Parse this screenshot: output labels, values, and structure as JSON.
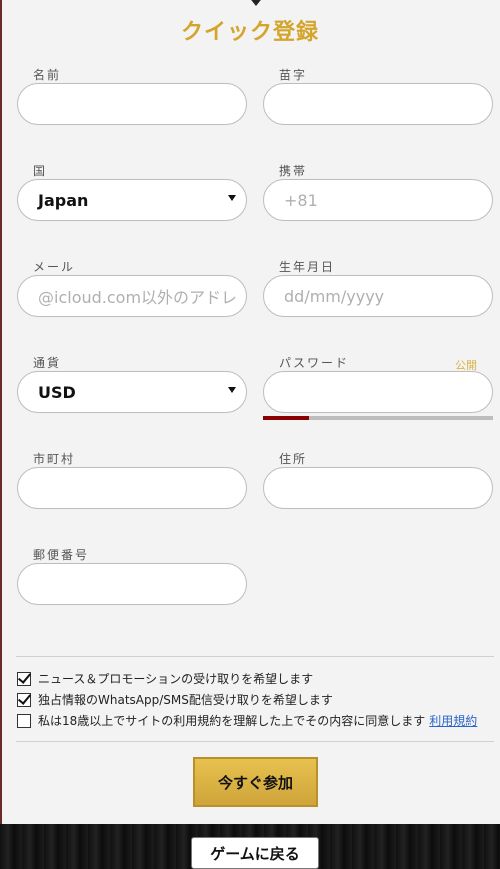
{
  "title": "クイック登録",
  "fields": {
    "first_name": {
      "label": "名前",
      "value": ""
    },
    "last_name": {
      "label": "苗字",
      "value": ""
    },
    "country": {
      "label": "国",
      "value": "Japan"
    },
    "mobile": {
      "label": "携帯",
      "placeholder": "+81"
    },
    "email": {
      "label": "メール",
      "placeholder": "@icloud.com以外のアドレ"
    },
    "dob": {
      "label": "生年月日",
      "placeholder": "dd/mm/yyyy"
    },
    "currency": {
      "label": "通貨",
      "value": "USD"
    },
    "password": {
      "label": "パスワード",
      "toggle": "公開",
      "strength": 0.2
    },
    "city": {
      "label": "市町村",
      "value": ""
    },
    "address": {
      "label": "住所",
      "value": ""
    },
    "postal_code": {
      "label": "郵便番号",
      "value": ""
    }
  },
  "consents": [
    {
      "label": "ニュース＆プロモーションの受け取りを希望します",
      "checked": true
    },
    {
      "label": "独占情報のWhatsApp/SMS配信受け取りを希望します",
      "checked": true
    },
    {
      "label": "私は18歳以上でサイトの利用規約を理解した上でその内容に同意します",
      "checked": false,
      "link": "利用規約"
    }
  ],
  "join_button": "今すぐ参加",
  "back_button": "ゲームに戻る",
  "colors": {
    "accent_gold": "#d4a52c",
    "strength_bar": "#8b0000",
    "link": "#2a66c8"
  }
}
